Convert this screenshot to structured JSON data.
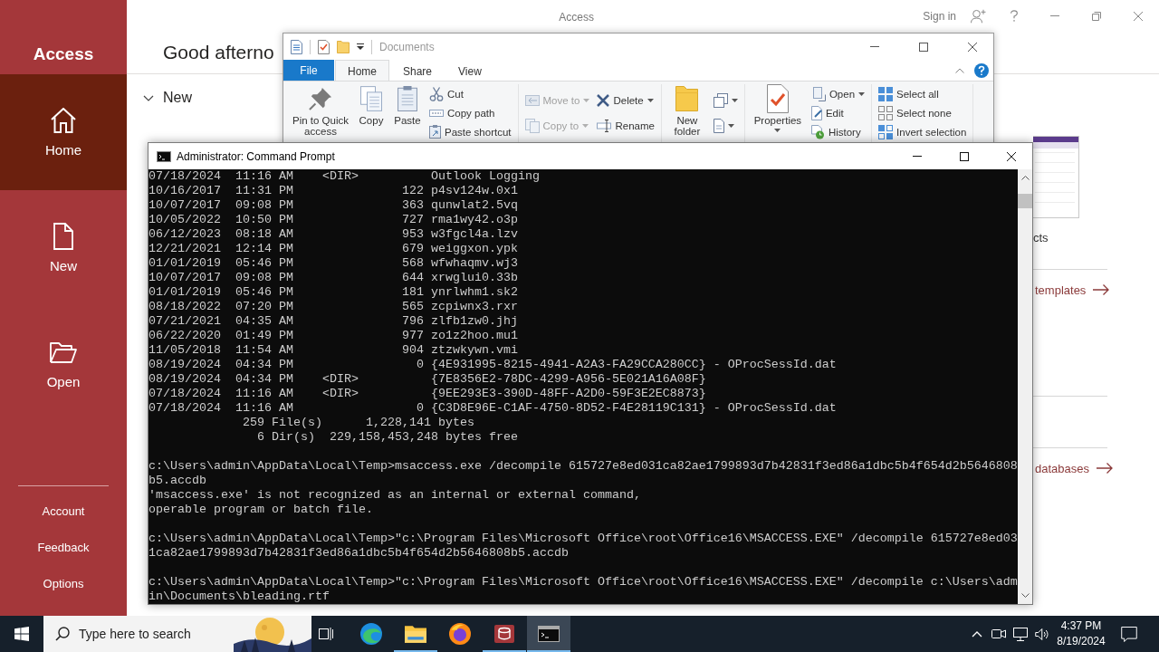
{
  "access": {
    "title": "Access",
    "sign_in": "Sign in",
    "app_name": "Access",
    "sidebar": [
      {
        "kind": "home",
        "label": "Home",
        "selected": true
      },
      {
        "kind": "new",
        "label": "New",
        "selected": false
      },
      {
        "kind": "open",
        "label": "Open",
        "selected": false
      }
    ],
    "sidebar_footer": [
      "Account",
      "Feedback",
      "Options"
    ],
    "greeting": "Good afterno",
    "section": {
      "title": "New",
      "expanded": true
    },
    "template_caption": "cts",
    "links": [
      "templates",
      "databases"
    ]
  },
  "explorer": {
    "title": "Documents",
    "file_tab": "File",
    "tabs": [
      {
        "label": "Home",
        "selected": true
      },
      {
        "label": "Share",
        "selected": false
      },
      {
        "label": "View",
        "selected": false
      }
    ],
    "groups": [
      {
        "large": [
          {
            "kind": "pin",
            "label": "Pin to Quick access",
            "dropdown": false,
            "disabled": false
          },
          {
            "kind": "copy",
            "label": "Copy",
            "dropdown": false,
            "disabled": false
          },
          {
            "kind": "paste",
            "label": "Paste",
            "dropdown": false,
            "disabled": false
          }
        ],
        "small": [
          [
            {
              "kind": "cut",
              "label": "Cut",
              "dropdown": false,
              "disabled": false
            },
            {
              "kind": "copy-path",
              "label": "Copy path",
              "dropdown": false,
              "disabled": false
            },
            {
              "kind": "paste-shortcut",
              "label": "Paste shortcut",
              "dropdown": false,
              "disabled": false
            }
          ]
        ]
      },
      {
        "small": [
          [
            {
              "kind": "move-to",
              "label": "Move to",
              "dropdown": true,
              "disabled": true
            },
            {
              "kind": "copy-to",
              "label": "Copy to",
              "dropdown": true,
              "disabled": true
            }
          ],
          [
            {
              "kind": "delete",
              "label": "Delete",
              "dropdown": true,
              "disabled": false
            },
            {
              "kind": "rename",
              "label": "Rename",
              "dropdown": false,
              "disabled": false
            }
          ]
        ]
      },
      {
        "large": [
          {
            "kind": "new-folder",
            "label": "New folder",
            "dropdown": false,
            "disabled": false
          }
        ],
        "small": [
          [
            {
              "kind": "new-item",
              "dropdown": true,
              "disabled": false
            },
            {
              "kind": "easy-access",
              "dropdown": true,
              "disabled": false
            }
          ]
        ]
      },
      {
        "large": [
          {
            "kind": "properties",
            "label": "Properties",
            "dropdown": true,
            "disabled": false
          }
        ],
        "small": [
          [
            {
              "kind": "open",
              "label": "Open",
              "dropdown": true,
              "disabled": false
            },
            {
              "kind": "edit",
              "label": "Edit",
              "dropdown": false,
              "disabled": false
            },
            {
              "kind": "history",
              "label": "History",
              "dropdown": false,
              "disabled": false
            }
          ]
        ]
      },
      {
        "small": [
          [
            {
              "kind": "select-all",
              "label": "Select all",
              "dropdown": false,
              "disabled": false
            },
            {
              "kind": "select-none",
              "label": "Select none",
              "dropdown": false,
              "disabled": false
            },
            {
              "kind": "invert-selection",
              "label": "Invert selection",
              "dropdown": false,
              "disabled": false
            }
          ]
        ]
      }
    ]
  },
  "console": {
    "title": "Administrator: Command Prompt",
    "blocks": [
      {
        "lines": [
          "07/18/2024  11:16 AM    <DIR>          Outlook Logging",
          "10/16/2017  11:31 PM               122 p4sv124w.0x1",
          "10/07/2017  09:08 PM               363 qunwlat2.5vq",
          "10/05/2022  10:50 PM               727 rma1wy42.o3p",
          "06/12/2023  08:18 AM               953 w3fgcl4a.lzv",
          "12/21/2021  12:14 PM               679 weiggxon.ypk",
          "01/01/2019  05:46 PM               568 wfwhaqmv.wj3",
          "10/07/2017  09:08 PM               644 xrwglui0.33b",
          "01/01/2019  05:46 PM               181 ynrlwhm1.sk2",
          "08/18/2022  07:20 PM               565 zcpiwnx3.rxr",
          "07/21/2021  04:35 AM               796 zlfb1zw0.jhj",
          "06/22/2020  01:49 PM               977 zo1z2hoo.mu1",
          "11/05/2018  11:54 AM               904 ztzwkywn.vmi",
          "08/19/2024  04:34 PM                 0 {4E931995-8215-4941-A2A3-FA29CCA280CC} - OProcSessId.dat",
          "08/19/2024  04:34 PM    <DIR>          {7E8356E2-78DC-4299-A956-5E021A16A08F}",
          "07/18/2024  11:16 AM    <DIR>          {9EE293E3-390D-48FF-A2D0-59F3E2EC8873}",
          "07/18/2024  11:16 AM                 0 {C3D8E96E-C1AF-4750-8D52-F4E28119C131} - OProcSessId.dat",
          "             259 File(s)      1,228,141 bytes",
          "               6 Dir(s)  229,158,453,248 bytes free"
        ]
      },
      {
        "lines": [
          "c:\\Users\\admin\\AppData\\Local\\Temp>msaccess.exe /decompile 615727e8ed031ca82ae1799893d7b42831f3ed86a1dbc5b4f654d2b5646808",
          "b5.accdb",
          "'msaccess.exe' is not recognized as an internal or external command,",
          "operable program or batch file."
        ]
      },
      {
        "lines": [
          "c:\\Users\\admin\\AppData\\Local\\Temp>\"c:\\Program Files\\Microsoft Office\\root\\Office16\\MSACCESS.EXE\" /decompile 615727e8ed03",
          "1ca82ae1799893d7b42831f3ed86a1dbc5b4f654d2b5646808b5.accdb"
        ]
      },
      {
        "lines": [
          "c:\\Users\\admin\\AppData\\Local\\Temp>\"c:\\Program Files\\Microsoft Office\\root\\Office16\\MSACCESS.EXE\" /decompile c:\\Users\\adm",
          "in\\Documents\\bleading.rtf"
        ]
      }
    ]
  },
  "taskbar": {
    "search_placeholder": "Type here to search",
    "apps": [
      {
        "kind": "edge",
        "running": false,
        "selected": false
      },
      {
        "kind": "explorer",
        "running": true,
        "selected": false
      },
      {
        "kind": "firefox",
        "running": false,
        "selected": false
      },
      {
        "kind": "access",
        "running": true,
        "selected": false
      },
      {
        "kind": "cmd",
        "running": true,
        "selected": true
      }
    ],
    "time": "4:37 PM",
    "date": "8/19/2024"
  }
}
